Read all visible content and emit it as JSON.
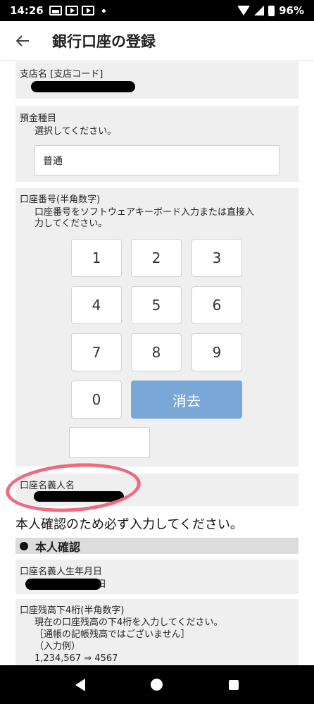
{
  "status_bar": {
    "time": "14:26",
    "battery": "96%"
  },
  "app_bar": {
    "title": "銀行口座の登録"
  },
  "branch": {
    "label": "支店名 [支店コード]"
  },
  "deposit_type": {
    "label": "預金種目",
    "instruction": "選択してください。",
    "value": "普通"
  },
  "account_number": {
    "label": "口座番号(半角数字)",
    "instruction_line1": "口座番号をソフトウェアキーボード入力または直接入",
    "instruction_line2": "力してください。",
    "keys": [
      "1",
      "2",
      "3",
      "4",
      "5",
      "6",
      "7",
      "8",
      "9",
      "0"
    ],
    "clear_label": "消去",
    "value": ""
  },
  "holder_name": {
    "label": "口座名義人名"
  },
  "notice": "本人確認のため必ず入力してください。",
  "identity": {
    "section_title": "本人確認",
    "birthdate_label": "口座名義人生年月日",
    "birthdate_suffix": "日",
    "balance_label": "口座残高下4桁(半角数字)",
    "balance_line1": "現在の口座残高の下4桁を入力してください。",
    "balance_line2": "［通帳の記帳残高ではございません］",
    "balance_line3": "（入力例）",
    "balance_line4": "1,234,567 ⇒ 4567"
  },
  "colors": {
    "clear_button": "#78a7d8",
    "card_bg": "#efefef",
    "highlight": "#ee6b7e"
  }
}
